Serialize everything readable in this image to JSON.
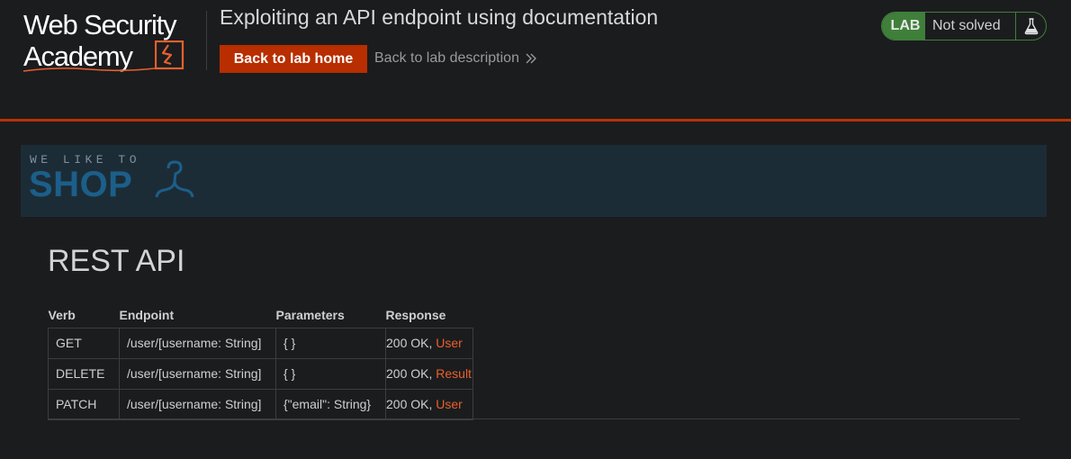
{
  "header": {
    "logo_line1": "Web Security",
    "logo_line2": "Academy",
    "lab_title": "Exploiting an API endpoint using documentation",
    "back_home_label": "Back to lab home",
    "back_description_label": "Back to lab description",
    "lab_badge": "LAB",
    "lab_status": "Not solved"
  },
  "shop": {
    "tagline": "WE LIKE TO",
    "name": "SHOP"
  },
  "main": {
    "heading": "REST API",
    "table": {
      "headers": [
        "Verb",
        "Endpoint",
        "Parameters",
        "Response"
      ],
      "rows": [
        {
          "verb": "GET",
          "endpoint": "/user/[username: String]",
          "parameters": "{ }",
          "response_status": "200 OK, ",
          "response_link": "User"
        },
        {
          "verb": "DELETE",
          "endpoint": "/user/[username: String]",
          "parameters": "{ }",
          "response_status": "200 OK, ",
          "response_link": "Result"
        },
        {
          "verb": "PATCH",
          "endpoint": "/user/[username: String]",
          "parameters": "{\"email\": String}",
          "response_status": "200 OK, ",
          "response_link": "User"
        }
      ]
    }
  },
  "colors": {
    "background": "#1b1c1e",
    "accent_orange": "#b82e00",
    "link_orange": "#e8602c",
    "lab_green": "#3f7f3a",
    "shop_blue": "#1b5f8a",
    "shop_bg": "#1c2c36"
  },
  "icons": {
    "logo": "lightning-bolt-icon",
    "lab": "flask-icon",
    "shop": "hanger-icon",
    "link": "chevron-right-double-icon"
  }
}
